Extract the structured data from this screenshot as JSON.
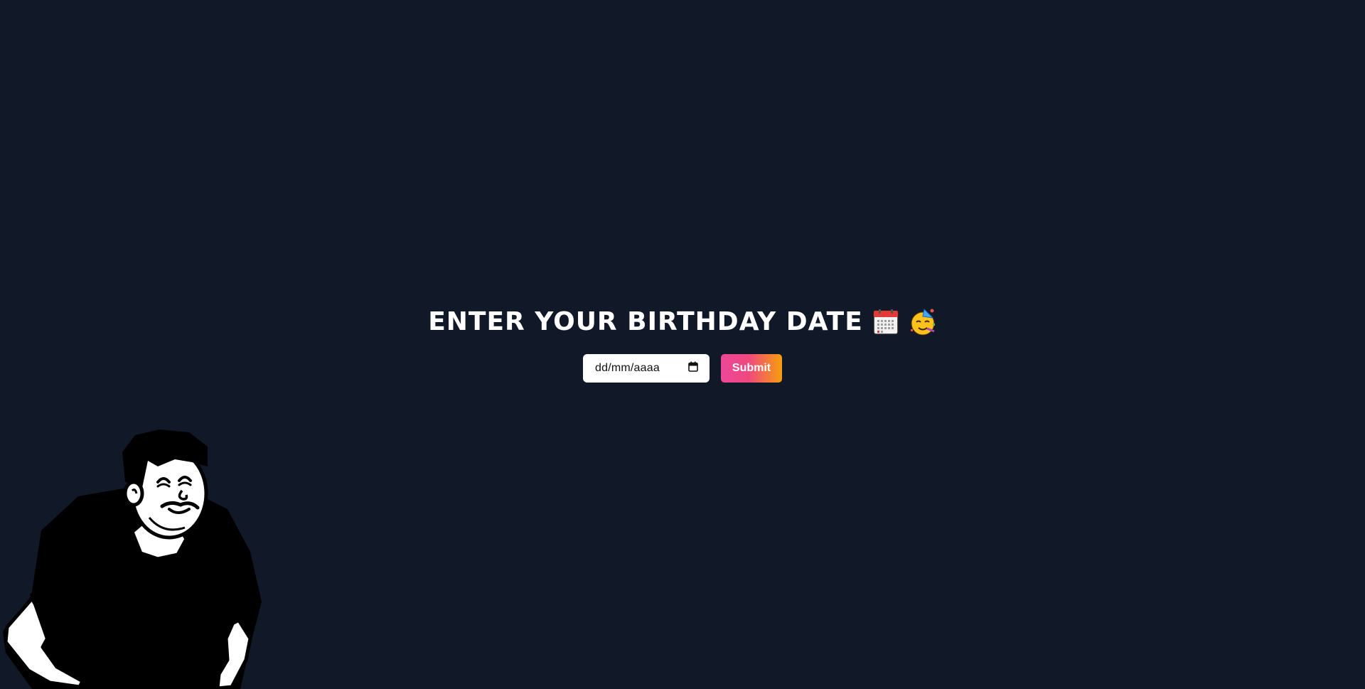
{
  "page": {
    "background": "#111827"
  },
  "heading": {
    "text": "ENTER YOUR BIRTHDAY DATE",
    "emoji_1": "calendar-emoji",
    "emoji_2": "partying-face-emoji"
  },
  "form": {
    "date_placeholder": "dd/mm/aaaa",
    "calendar_icon": "calendar-icon",
    "submit_label": "Submit",
    "submit_gradient": [
      "#ec4899",
      "#f59e0b"
    ]
  },
  "illustration": {
    "name": "smiling-man-illustration"
  }
}
